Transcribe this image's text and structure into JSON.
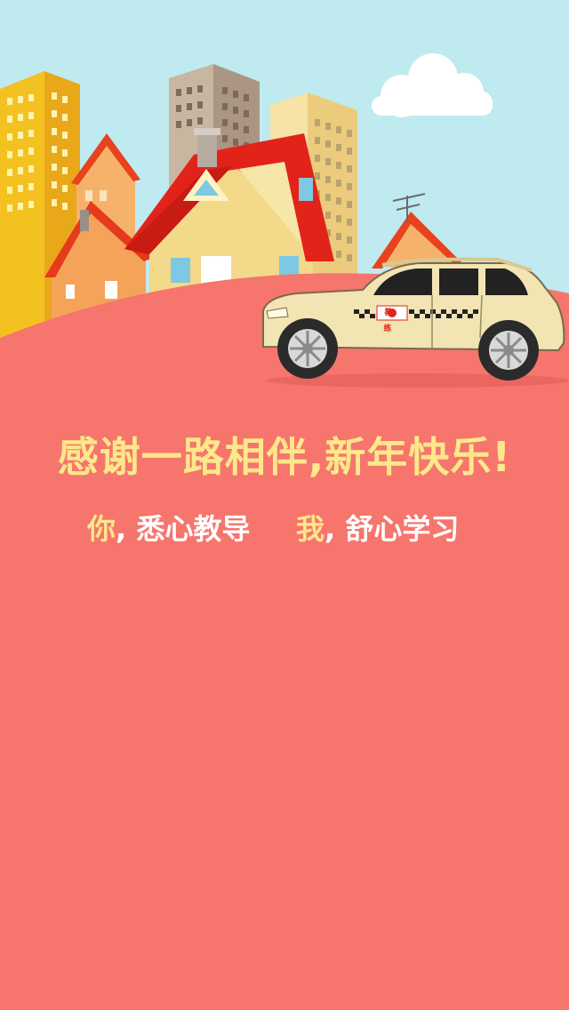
{
  "colors": {
    "sky": "#bfeaf0",
    "ground": "#f6756d",
    "headline_text": "#fde88a",
    "sub_highlight": "#fde88a",
    "sub_plain": "#ffffff",
    "taxi_body": "#f2e5b3",
    "roof_red": "#e2231a"
  },
  "headline": {
    "text": "感谢一路相伴,新年快乐!"
  },
  "subline": {
    "left_highlight": "你",
    "left_rest": ", 悉心教导",
    "right_highlight": "我",
    "right_rest": ", 舒心学习"
  },
  "taxi": {
    "door_logo_text": "教练"
  },
  "icons": {
    "cloud": "cloud-icon",
    "taxi": "taxi-car-icon",
    "antenna": "antenna-icon"
  }
}
